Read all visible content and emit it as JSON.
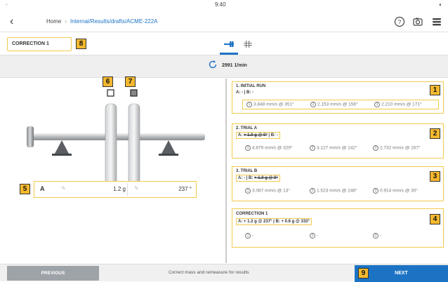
{
  "status_bar": {
    "time": "9:40"
  },
  "nav": {
    "back_glyph": "‹",
    "home": "Home",
    "separator": "›",
    "path": "Internal/Results/drafts/ACME-222A",
    "icons": [
      "help-icon",
      "camera-settings-icon",
      "menu-icon"
    ]
  },
  "tab_row": {
    "correction_label": "CORRECTION 1",
    "badge": "8",
    "tabs": [
      {
        "icon": "balance-view-icon",
        "active": true
      },
      {
        "icon": "table-view-icon",
        "active": false
      }
    ]
  },
  "rpm": {
    "value": "2991 1/min"
  },
  "left_panel": {
    "weight_input": {
      "badge": "5",
      "plane": "A",
      "mass": "1.2 g",
      "angle": "237 °"
    },
    "badge_plane_a": "6",
    "badge_plane_b": "7"
  },
  "cards": {
    "initial_run": {
      "badge": "1",
      "title": "1. INITIAL RUN",
      "sub": "A: - | B: -",
      "measurements": [
        {
          "num": "1",
          "value": "3.848 mm/s @ 351°"
        },
        {
          "num": "2",
          "value": "2.153 mm/s @ 156°"
        },
        {
          "num": "3",
          "value": "2.210 mm/s @ 171°"
        }
      ]
    },
    "trial_a": {
      "badge": "2",
      "title": "2. TRIAL A",
      "sub_prefix": "A: ",
      "sub_struck": "+ 1.0 g @ 0°",
      "sub_suffix": " | B: -",
      "measurements": [
        {
          "num": "1",
          "value": "4.879 mm/s @ 329°"
        },
        {
          "num": "2",
          "value": "3.127 mm/s @ 142°"
        },
        {
          "num": "3",
          "value": "2.732 mm/s @ 167°"
        }
      ]
    },
    "trial_b": {
      "badge": "3",
      "title": "3. TRIAL B",
      "sub_prefix": "A: - | B: ",
      "sub_struck": "+ 1.0 g @ 0°",
      "measurements": [
        {
          "num": "1",
          "value": "3.087 mm/s @ 13°"
        },
        {
          "num": "2",
          "value": "1.523 mm/s @ 248°"
        },
        {
          "num": "3",
          "value": "0.914 mm/s @ 30°"
        }
      ]
    },
    "correction": {
      "badge": "4",
      "title": "CORRECTION 1",
      "sub": "A: + 1.2 g @ 237° | B: + 0.6 g @ 333°",
      "measurements": [
        {
          "num": "1",
          "value": "-"
        },
        {
          "num": "2",
          "value": "-"
        },
        {
          "num": "3",
          "value": "-"
        }
      ]
    }
  },
  "bottom": {
    "previous": "PREVIOUS",
    "hint": "Correct mass and remeasure for results",
    "next": "NEXT",
    "next_badge": "9"
  },
  "colors": {
    "accent": "#1c73c4",
    "highlight": "#f2c94c",
    "badge": "#f5b82e",
    "previous_button": "#9ea3a8"
  }
}
